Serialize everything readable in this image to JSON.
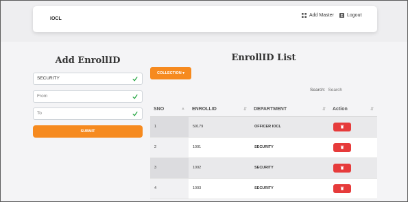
{
  "navbar": {
    "brand": "IOCL",
    "add_master": "Add Master",
    "logout": "Logout"
  },
  "form": {
    "title": "Add EnrollID",
    "department_value": "SECURITY",
    "from_placeholder": "From",
    "to_placeholder": "To",
    "submit_label": "SUBMIT"
  },
  "list": {
    "title": "EnrollID List",
    "collection_label": "COLLECTION ▾",
    "search_label": "Search:",
    "search_placeholder": "Search",
    "columns": [
      "SNO",
      "ENROLLID",
      "DEPARTMENT",
      "Action"
    ],
    "rows": [
      {
        "sno": "1",
        "enrollid": "59179",
        "department": "OFFICER IOCL"
      },
      {
        "sno": "2",
        "enrollid": "1001",
        "department": "SECURITY"
      },
      {
        "sno": "3",
        "enrollid": "1002",
        "department": "SECURITY"
      },
      {
        "sno": "4",
        "enrollid": "1003",
        "department": "SECURITY"
      }
    ]
  },
  "colors": {
    "accent": "#f68a1f",
    "danger": "#e63b3b",
    "valid": "#28a745"
  },
  "icons": {
    "add_master": "grid-icon",
    "logout": "user-box-icon",
    "valid": "check-icon",
    "delete": "trash-icon",
    "sort": "sort-icon"
  }
}
